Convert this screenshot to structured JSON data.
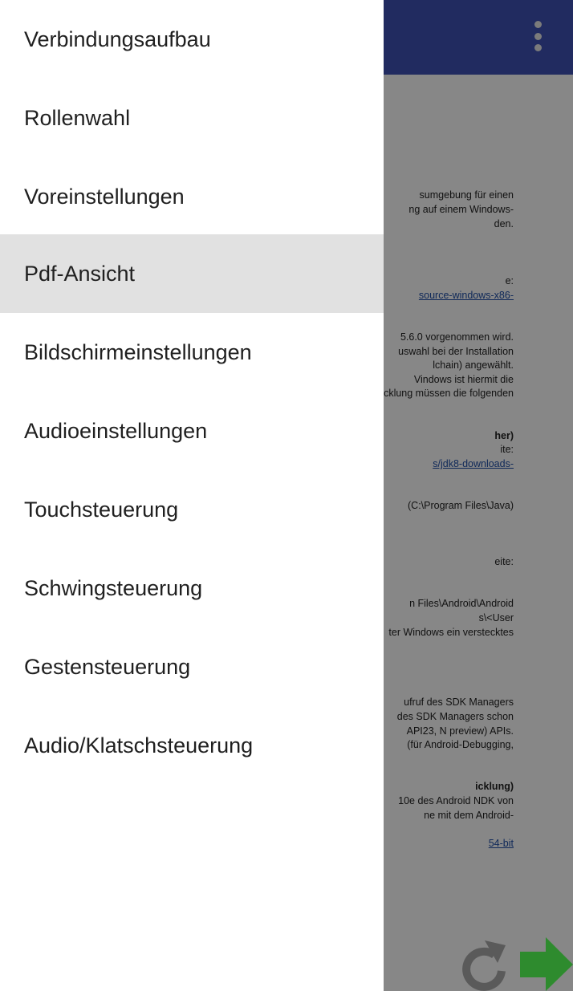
{
  "nav_drawer": {
    "items": [
      {
        "label": "Verbindungsaufbau"
      },
      {
        "label": "Rollenwahl"
      },
      {
        "label": "Voreinstellungen"
      },
      {
        "label": "Pdf-Ansicht",
        "selected": true
      },
      {
        "label": "Bildschirmeinstellungen"
      },
      {
        "label": "Audioeinstellungen"
      },
      {
        "label": "Touchsteuerung"
      },
      {
        "label": "Schwingsteuerung"
      },
      {
        "label": "Gestensteuerung"
      },
      {
        "label": "Audio/Klatschsteuerung"
      }
    ]
  },
  "app_bar": {
    "color": "#3f51b5",
    "overflow_icon": "more-vert-icon"
  },
  "document": {
    "lines": [
      {
        "text": "sumgebung für einen",
        "style": "normal"
      },
      {
        "text": "ng auf einem Windows-",
        "style": "normal"
      },
      {
        "text": "den.",
        "style": "normal"
      },
      {
        "text": "e:",
        "style": "normal"
      },
      {
        "text": "source-windows-x86-",
        "style": "link"
      },
      {
        "text": "5.6.0 vorgenommen wird.",
        "style": "normal"
      },
      {
        "text": "uswahl bei der Installation",
        "style": "normal"
      },
      {
        "text": "lchain) angewählt.",
        "style": "normal"
      },
      {
        "text": "Vindows ist hiermit die",
        "style": "normal"
      },
      {
        "text": "cklung müssen die folgenden",
        "style": "normal"
      },
      {
        "text": "her)",
        "style": "bold"
      },
      {
        "text": "ite:",
        "style": "normal"
      },
      {
        "text": "s/jdk8-downloads-",
        "style": "link"
      },
      {
        "text": "(C:\\Program Files\\Java)",
        "style": "normal"
      },
      {
        "text": "eite:",
        "style": "normal"
      },
      {
        "text": "n Files\\Android\\Android",
        "style": "normal"
      },
      {
        "text": "s\\<User",
        "style": "normal"
      },
      {
        "text": "ter Windows ein verstecktes",
        "style": "normal"
      },
      {
        "text": "ufruf des SDK Managers",
        "style": "normal"
      },
      {
        "text": "des SDK Managers schon",
        "style": "normal"
      },
      {
        "text": "API23, N preview) APIs.",
        "style": "normal"
      },
      {
        "text": "(für Android-Debugging,",
        "style": "normal"
      },
      {
        "text": "icklung)",
        "style": "bold"
      },
      {
        "text": "10e des Android NDK von",
        "style": "normal"
      },
      {
        "text": "ne mit dem Android-",
        "style": "normal"
      },
      {
        "text": "54-bit",
        "style": "link"
      }
    ]
  },
  "bottom_controls": {
    "refresh_icon": "refresh-icon",
    "next_icon": "arrow-right-icon",
    "next_color": "#2e8b2e",
    "refresh_color": "#5a5a5a"
  }
}
